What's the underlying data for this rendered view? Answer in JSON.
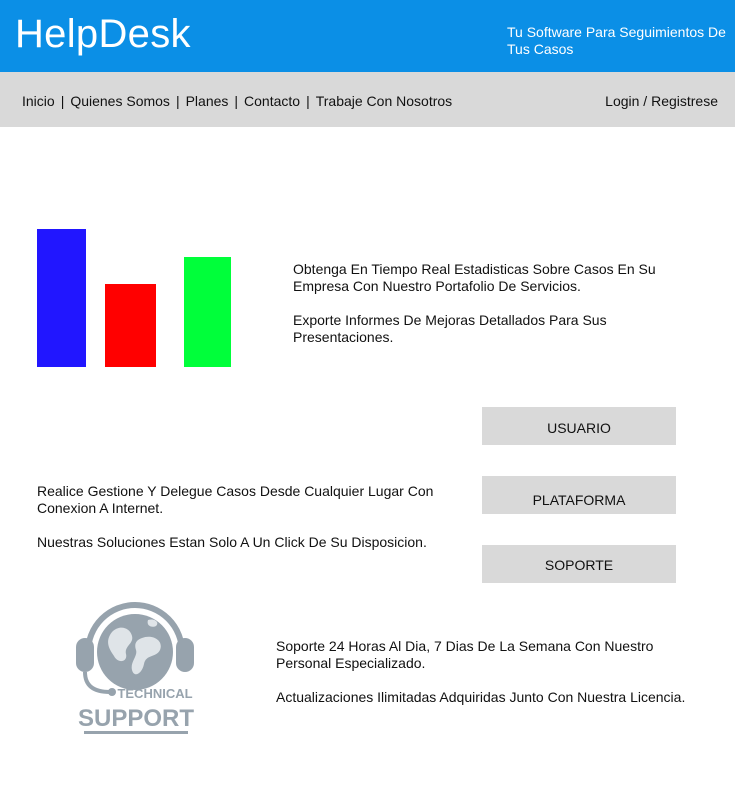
{
  "header": {
    "title": "HelpDesk",
    "tagline": "Tu Software Para Seguimientos De Tus Casos",
    "bg_color": "#0b8fe6"
  },
  "nav": {
    "items": [
      "Inicio",
      "Quienes Somos",
      "Planes",
      "Contacto",
      "Trabaje Con Nosotros"
    ],
    "separator": "|",
    "login": "Login / Registrese"
  },
  "section1": {
    "paragraphs": [
      "Obtenga En Tiempo Real Estadisticas Sobre Casos En Su Empresa Con Nuestro Portafolio De Servicios.",
      "Exporte Informes De Mejoras Detallados Para Sus Presentaciones."
    ]
  },
  "chart_data": {
    "type": "bar",
    "categories": [
      "",
      "",
      ""
    ],
    "values": [
      100,
      60,
      80
    ],
    "colors": [
      "#2116ff",
      "#ff0000",
      "#00ff3a"
    ],
    "title": "",
    "xlabel": "",
    "ylabel": ""
  },
  "section2": {
    "paragraphs": [
      "Realice Gestione Y Delegue Casos Desde Cualquier Lugar Con Conexion A Internet.",
      "Nuestras Soluciones Estan Solo A Un Click De Su Disposicion."
    ],
    "buttons": [
      "USUARIO",
      "PLATAFORMA",
      "SOPORTE"
    ]
  },
  "section3": {
    "logo_text_top": "TECHNICAL",
    "logo_text_bottom": "SUPPORT",
    "logo_icon": "headset-globe-icon",
    "paragraphs": [
      "Soporte 24 Horas Al Dia, 7 Dias De La Semana Con Nuestro Personal Especializado.",
      "Actualizaciones Ilimitadas Adquiridas Junto Con Nuestra Licencia."
    ]
  }
}
